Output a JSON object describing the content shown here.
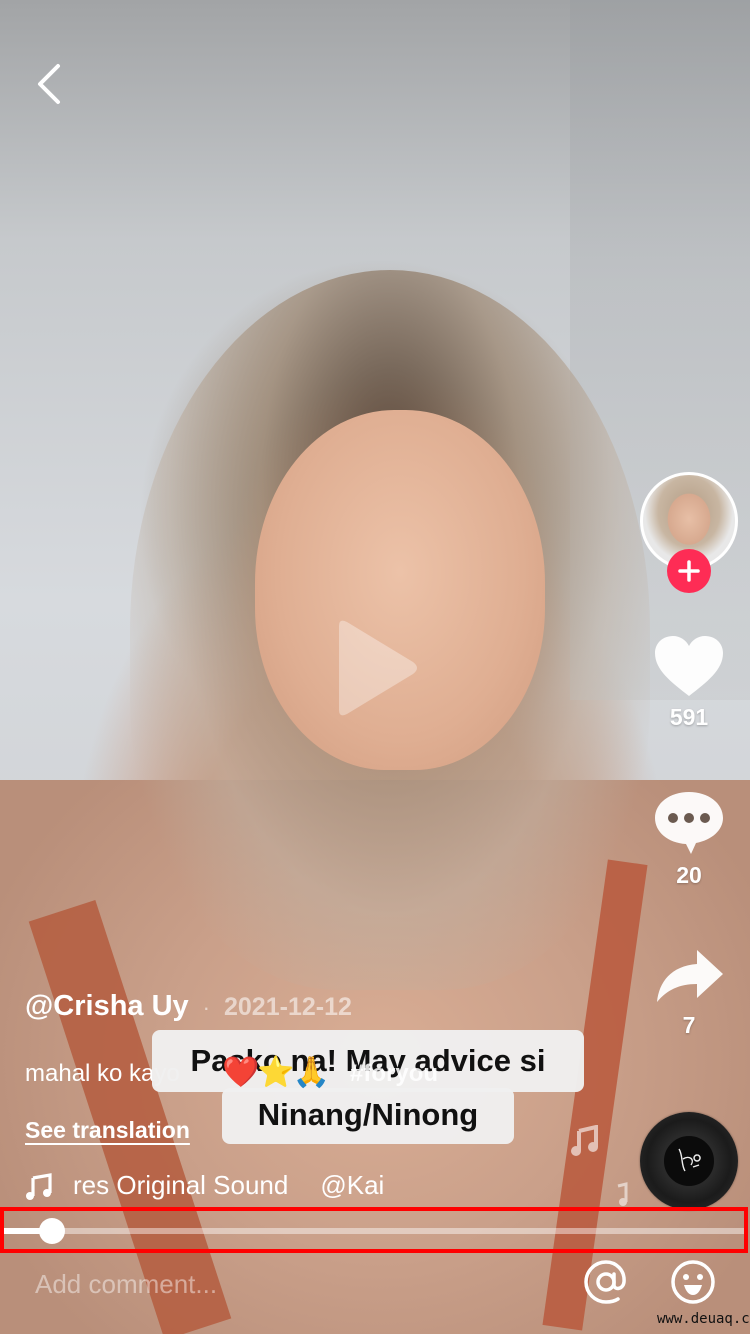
{
  "app": {
    "name": "TikTok",
    "screen": "video-player"
  },
  "navigation": {
    "back_icon": "chevron-left-icon"
  },
  "video": {
    "state": "paused",
    "play_icon": "play-icon",
    "sticker_text": {
      "line1": "Pasko na! May advice si",
      "line2": "Ninang/Ninong"
    },
    "progress": {
      "fraction": 0.065
    }
  },
  "rail": {
    "avatar_icon": "creator-avatar",
    "follow_icon": "plus-icon",
    "like": {
      "icon": "heart-icon",
      "count": "591"
    },
    "comment": {
      "icon": "comment-bubble-icon",
      "count": "20"
    },
    "share": {
      "icon": "share-arrow-icon",
      "count": "7"
    },
    "sound_disc_icon": "music-disc-icon"
  },
  "post": {
    "author": "@Crisha Uy",
    "date_separator": "·",
    "date": "2021-12-12",
    "caption": "mahal ko kayo",
    "emojis": "❤️⭐🙏",
    "hashtag": "#foryou",
    "see_translation": "See translation",
    "sound_icon": "music-note-icon",
    "sound_title": "res Original Sound",
    "sound_author": "@Kai"
  },
  "comment_bar": {
    "placeholder": "Add comment...",
    "mention_icon": "at-sign-icon",
    "emoji_icon": "smiley-icon"
  },
  "watermark": "www.deuaq.com",
  "colors": {
    "accent": "#fe2c55",
    "highlight": "#ff0000",
    "text": "#ffffff"
  }
}
